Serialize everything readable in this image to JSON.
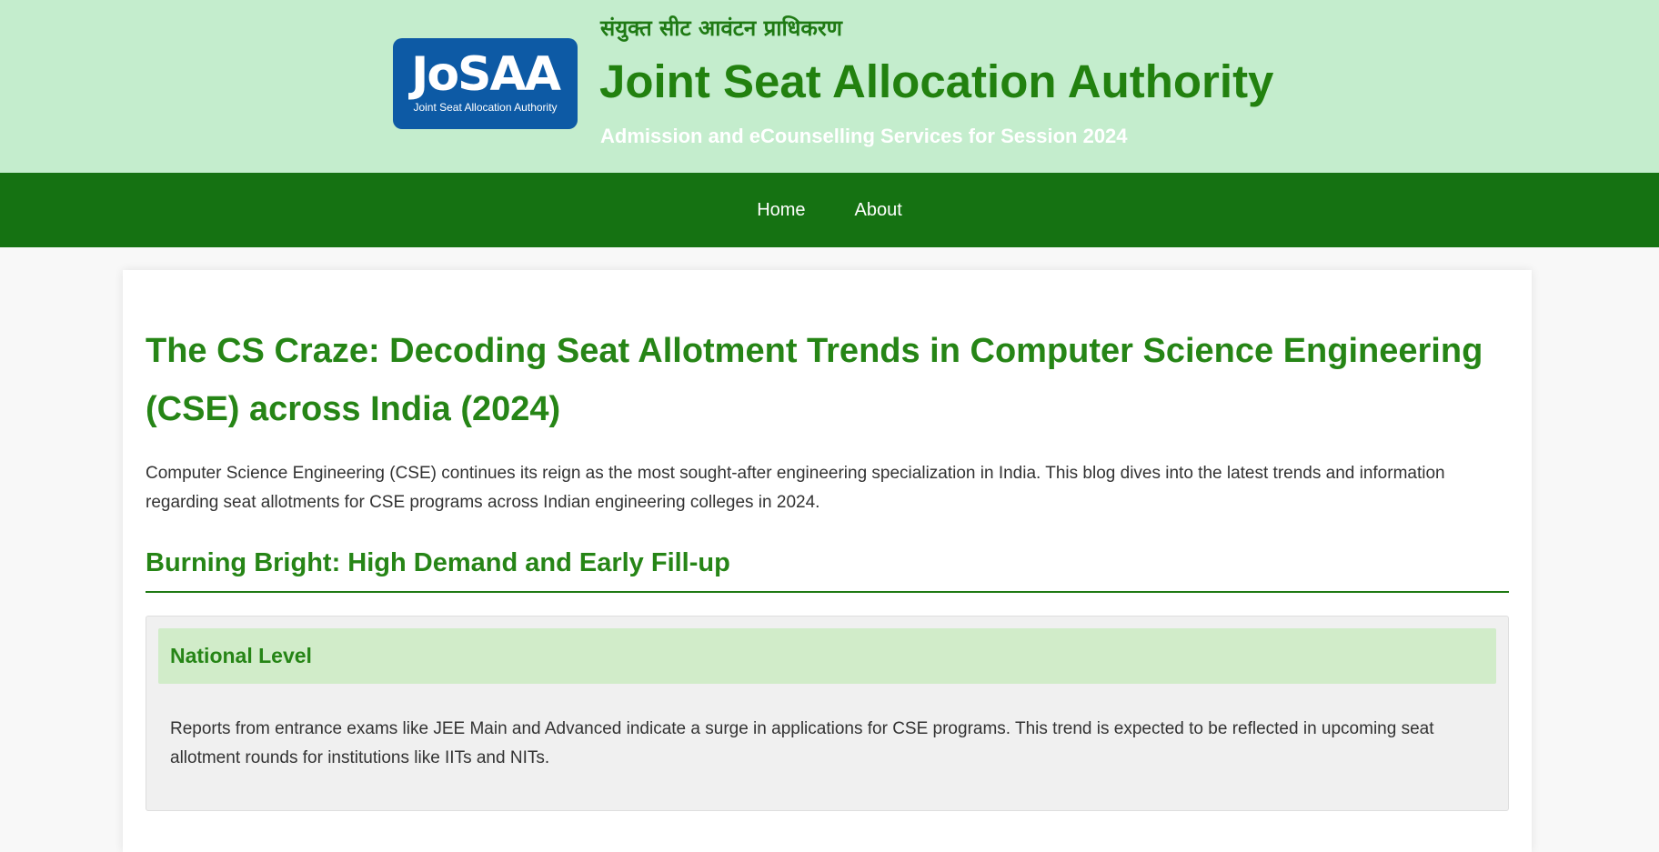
{
  "header": {
    "logo_text": "JoSAA",
    "logo_subtext": "Joint Seat Allocation Authority",
    "hindi_title": "संयुक्त सीट आवंटन प्राधिकरण",
    "title": "Joint Seat Allocation Authority",
    "tagline": "Admission and eCounselling Services for Session 2024"
  },
  "nav": {
    "items": [
      {
        "label": "Home"
      },
      {
        "label": "About"
      }
    ]
  },
  "article": {
    "title": "The CS Craze: Decoding Seat Allotment Trends in Computer Science Engineering (CSE) across India (2024)",
    "intro": "Computer Science Engineering (CSE) continues its reign as the most sought-after engineering specialization in India. This blog dives into the latest trends and information regarding seat allotments for CSE programs across Indian engineering colleges in 2024.",
    "section_heading": "Burning Bright: High Demand and Early Fill-up",
    "panel": {
      "heading": "National Level",
      "body": "Reports from entrance exams like JEE Main and Advanced indicate a surge in applications for CSE programs. This trend is expected to be reflected in upcoming seat allotment rounds for institutions like IITs and NITs."
    }
  },
  "colors": {
    "header_bg": "#c4edcd",
    "nav_bg": "#157212",
    "accent_green": "#268516",
    "logo_blue": "#0d5aa5"
  }
}
